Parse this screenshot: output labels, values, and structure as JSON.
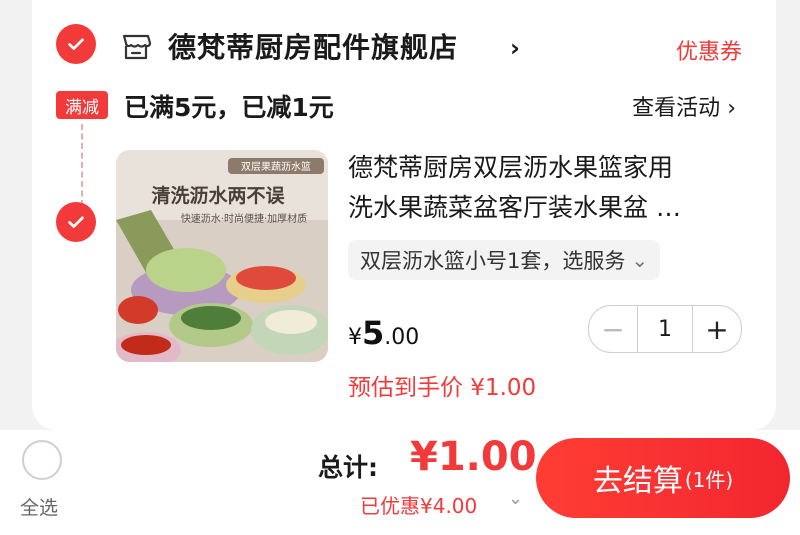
{
  "store": {
    "name": "德梵蒂厨房配件旗舰店",
    "chevron": "›",
    "coupon_label": "优惠券"
  },
  "promo": {
    "tag": "满减",
    "text": "已满5元，已减1元",
    "link": "查看活动",
    "link_chevron": "›"
  },
  "product": {
    "title_line1": "德梵蒂厨房双层沥水果篮家用",
    "title_line2": "洗水果蔬菜盆客厅装水果盆 …",
    "image_banner": "清洗沥水两不误",
    "image_tag": "双层果蔬沥水篮",
    "image_caption": "快速沥水·时尚便捷·加厚材质",
    "sku": "双层沥水篮小号1套，选服务",
    "sku_chevron": "⌄",
    "price_currency": "¥",
    "price_int": "5",
    "price_dec": ".00",
    "estimate": "预估到手价 ¥1.00",
    "quantity": "1",
    "minus": "−",
    "plus": "+"
  },
  "footer": {
    "select_all": "全选",
    "total_label": "总计:",
    "total_amount": "¥1.00",
    "discount": "已优惠¥4.00",
    "discount_chevron": "⌄",
    "checkout_label": "去结算",
    "checkout_count": "(1件)"
  },
  "colors": {
    "accent": "#f23a3a",
    "background": "#f2f2f2"
  },
  "icons": [
    "checkmark-icon",
    "store-icon",
    "chevron-right-icon",
    "chevron-down-icon"
  ]
}
